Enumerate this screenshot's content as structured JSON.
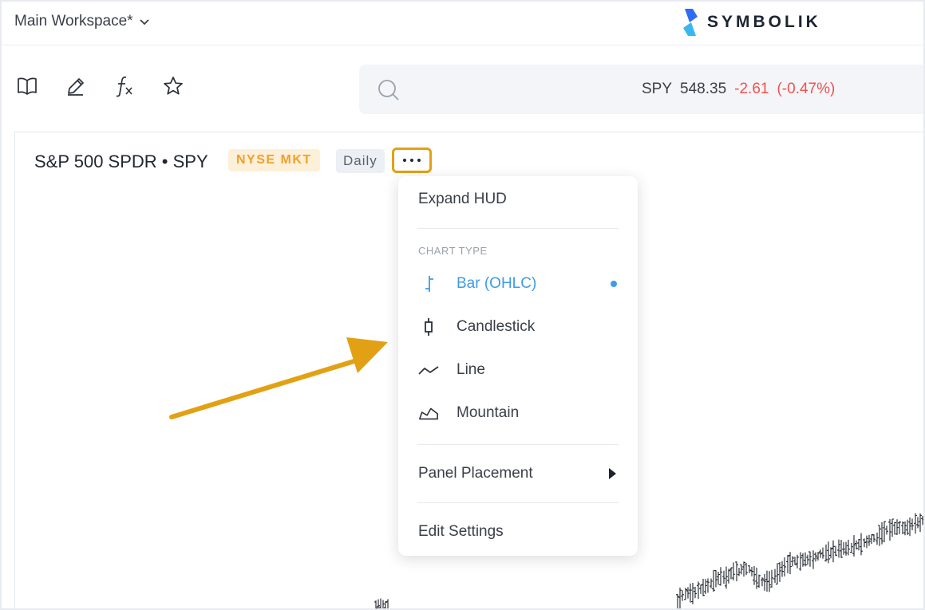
{
  "header": {
    "workspace_label": "Main Workspace*",
    "brand_name": "SYMBOLIK"
  },
  "toolbar": {
    "icons": [
      "book-icon",
      "pencil-icon",
      "function-icon",
      "star-icon"
    ],
    "search_placeholder": "",
    "quote": {
      "symbol": "SPY",
      "price": "548.35",
      "change": "-2.61",
      "change_pct": "(-0.47%)"
    }
  },
  "panel": {
    "title": "S&P 500 SPDR • SPY",
    "exchange_badge": "NYSE MKT",
    "interval_badge": "Daily"
  },
  "menu": {
    "expand_hud": "Expand HUD",
    "section_chart_type": "CHART TYPE",
    "chart_types": [
      {
        "label": "Bar (OHLC)",
        "icon": "ohlc-bar-icon",
        "selected": true
      },
      {
        "label": "Candlestick",
        "icon": "candlestick-icon",
        "selected": false
      },
      {
        "label": "Line",
        "icon": "line-chart-icon",
        "selected": false
      },
      {
        "label": "Mountain",
        "icon": "mountain-chart-icon",
        "selected": false
      }
    ],
    "panel_placement": "Panel Placement",
    "edit_settings": "Edit Settings"
  },
  "colors": {
    "accent_blue": "#3d9be9",
    "highlight_orange": "#e2a114",
    "negative_red": "#ef5350",
    "exchange_badge_text": "#f0a02a"
  }
}
